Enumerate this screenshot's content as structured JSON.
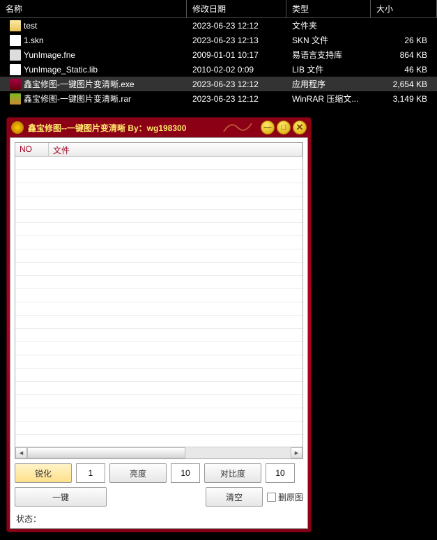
{
  "explorer": {
    "columns": {
      "name": "名称",
      "date": "修改日期",
      "type": "类型",
      "size": "大小"
    },
    "rows": [
      {
        "name": "test",
        "date": "2023-06-23 12:12",
        "type": "文件夹",
        "size": "",
        "icon": "folder"
      },
      {
        "name": "1.skn",
        "date": "2023-06-23 12:13",
        "type": "SKN 文件",
        "size": "26 KB",
        "icon": "file"
      },
      {
        "name": "YunImage.fne",
        "date": "2009-01-01 10:17",
        "type": "易语言支持库",
        "size": "864 KB",
        "icon": "lib"
      },
      {
        "name": "YunImage_Static.lib",
        "date": "2010-02-02 0:09",
        "type": "LIB 文件",
        "size": "46 KB",
        "icon": "file"
      },
      {
        "name": "鑫宝修图-一键图片变清晰.exe",
        "date": "2023-06-23 12:12",
        "type": "应用程序",
        "size": "2,654 KB",
        "icon": "exe",
        "selected": true
      },
      {
        "name": "鑫宝修图-一键图片变清晰.rar",
        "date": "2023-06-23 12:12",
        "type": "WinRAR 压缩文...",
        "size": "3,149 KB",
        "icon": "rar"
      }
    ]
  },
  "app": {
    "title": "鑫宝修图--一键图片变清晰 By：wg198300",
    "list_headers": {
      "no": "NO",
      "file": "文件"
    },
    "buttons": {
      "sharpen": "锐化",
      "brightness": "亮度",
      "contrast": "对比度",
      "onekey": "一键",
      "clear": "清空"
    },
    "values": {
      "sharpen": "1",
      "brightness": "10",
      "contrast": "10"
    },
    "checkbox": {
      "delete_original": "删原图"
    },
    "status_label": "状态："
  }
}
